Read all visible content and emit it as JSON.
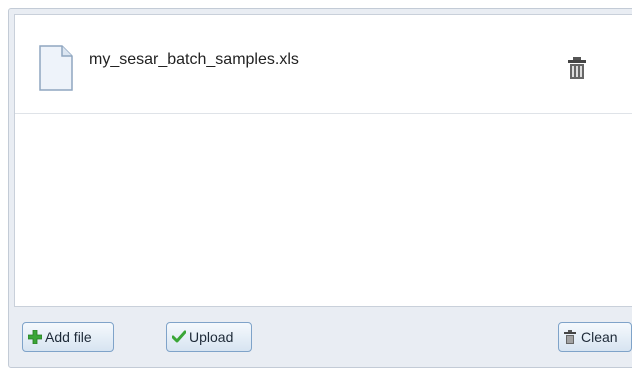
{
  "file_list": {
    "items": [
      {
        "name": "my_sesar_batch_samples.xls",
        "icon": "document-icon",
        "action_icon": "trash-icon"
      }
    ]
  },
  "toolbar": {
    "add_label": "Add file",
    "add_icon": "plus-icon",
    "upload_label": "Upload",
    "upload_icon": "checkmark-icon",
    "clean_label": "Clean",
    "clean_icon": "trash-icon"
  },
  "colors": {
    "add_icon": "#3aa637",
    "upload_icon": "#3aa637",
    "button_border": "#7fa3c9"
  }
}
